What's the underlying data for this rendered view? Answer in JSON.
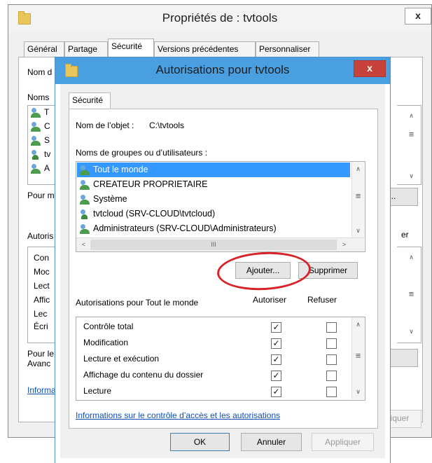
{
  "back": {
    "title": "Propriétés de : tvtools",
    "close": "x",
    "tabs": [
      "Général",
      "Partage",
      "Sécurité",
      "Versions précédentes",
      "Personnaliser"
    ],
    "fragments": {
      "object_name": "Nom d",
      "groups": "Noms",
      "row_t": "T",
      "row_c": "C",
      "row_s": "S",
      "row_tv": "tv",
      "row_a": "A",
      "pour_m": "Pour m",
      "autoris": "Autoris",
      "perm_con": "Con",
      "perm_mod": "Moc",
      "perm_lec": "Lect",
      "perm_aff": "Affic",
      "perm_lec2": "Lec",
      "perm_ecr": "Écri",
      "pour_le": "Pour le",
      "avanc": "Avanc",
      "informa": "Informa",
      "btn_r": "r...",
      "er": "er",
      "btn_e": "é",
      "scroll_mid": "≡",
      "apply_frag": "liquer"
    }
  },
  "dialog": {
    "title": "Autorisations pour tvtools",
    "close": "x",
    "tab": "Sécurité",
    "object_label": "Nom de l’objet :",
    "object_value": "C:\\tvtools",
    "groups_label": "Noms de groupes ou d’utilisateurs :",
    "users": [
      {
        "name": "Tout le monde",
        "icon": "group-icon",
        "selected": true
      },
      {
        "name": "CREATEUR PROPRIETAIRE",
        "icon": "group-icon",
        "selected": false
      },
      {
        "name": "Système",
        "icon": "group-icon",
        "selected": false
      },
      {
        "name": "tvtcloud (SRV-CLOUD\\tvtcloud)",
        "icon": "user-icon",
        "selected": false
      },
      {
        "name": "Administrateurs (SRV-CLOUD\\Administrateurs)",
        "icon": "group-icon",
        "selected": false
      }
    ],
    "hscroll_thumb": "III",
    "add_button": "Ajouter...",
    "remove_button": "Supprimer",
    "permissions_label": "Autorisations pour Tout le monde",
    "allow_header": "Autoriser",
    "deny_header": "Refuser",
    "permissions": [
      {
        "name": "Contrôle total",
        "allow": true,
        "deny": false
      },
      {
        "name": "Modification",
        "allow": true,
        "deny": false
      },
      {
        "name": "Lecture et exécution",
        "allow": true,
        "deny": false
      },
      {
        "name": "Affichage du contenu du dossier",
        "allow": true,
        "deny": false
      },
      {
        "name": "Lecture",
        "allow": true,
        "deny": false
      }
    ],
    "check_mark": "✓",
    "scroll_mid": "≡",
    "info_link": "Informations sur le contrôle d’accès et les autorisations",
    "ok": "OK",
    "cancel": "Annuler",
    "apply": "Appliquer"
  },
  "colors": {
    "selection": "#3399ff",
    "dialog_titlebar": "#4a9fe0",
    "close_button": "#c8423c",
    "highlight_circle": "#d8232a",
    "link": "#0a4fb4"
  }
}
